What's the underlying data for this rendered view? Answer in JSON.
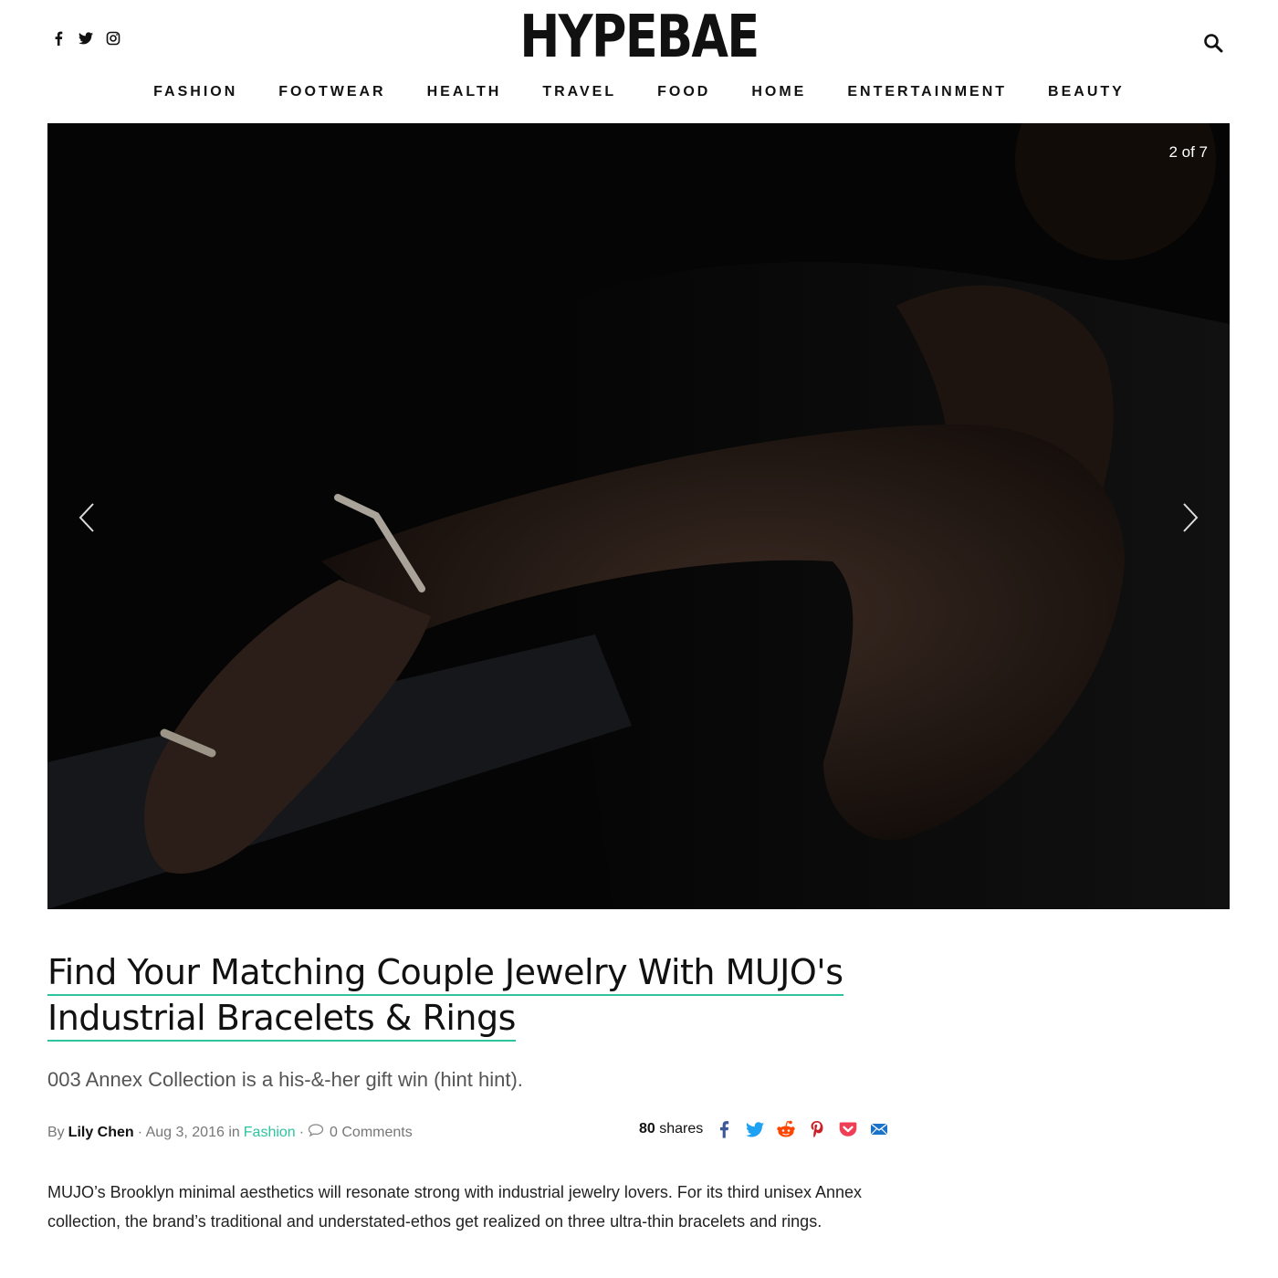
{
  "header": {
    "logo": "HYPEBAE",
    "social_icons": [
      "facebook-icon",
      "twitter-icon",
      "instagram-icon"
    ],
    "search_icon": "search-icon"
  },
  "nav": {
    "items": [
      "FASHION",
      "FOOTWEAR",
      "HEALTH",
      "TRAVEL",
      "FOOD",
      "HOME",
      "ENTERTAINMENT",
      "BEAUTY"
    ]
  },
  "slideshow": {
    "counter": "2 of 7",
    "prev_icon": "chevron-left-icon",
    "next_icon": "chevron-right-icon"
  },
  "article": {
    "title_line1": "Find Your Matching Couple Jewelry With MUJO's",
    "title_line2": "Industrial Bracelets & Rings",
    "subtitle": "003 Annex Collection is a his-&-her gift win (hint hint).",
    "by_label": "By",
    "author": "Lily Chen",
    "date": "· Aug 3, 2016 in",
    "category": "Fashion",
    "separator": "·",
    "comments": "0 Comments",
    "body": "MUJO’s Brooklyn minimal aesthetics will resonate strong with industrial jewelry lovers. For its third unisex Annex collection, the brand’s traditional and understated-ethos get realized on three ultra-thin bracelets and rings."
  },
  "shares": {
    "count": "80",
    "label": "shares",
    "icons": [
      "facebook-icon",
      "twitter-icon",
      "reddit-icon",
      "pinterest-icon",
      "pocket-icon",
      "email-icon"
    ]
  },
  "colors": {
    "accent": "#2ec4a0",
    "facebook": "#3b5998",
    "twitter": "#1da1f2",
    "reddit": "#ff4500",
    "pinterest": "#cb2027",
    "pocket": "#ef3f56",
    "email": "#1a73c9"
  }
}
